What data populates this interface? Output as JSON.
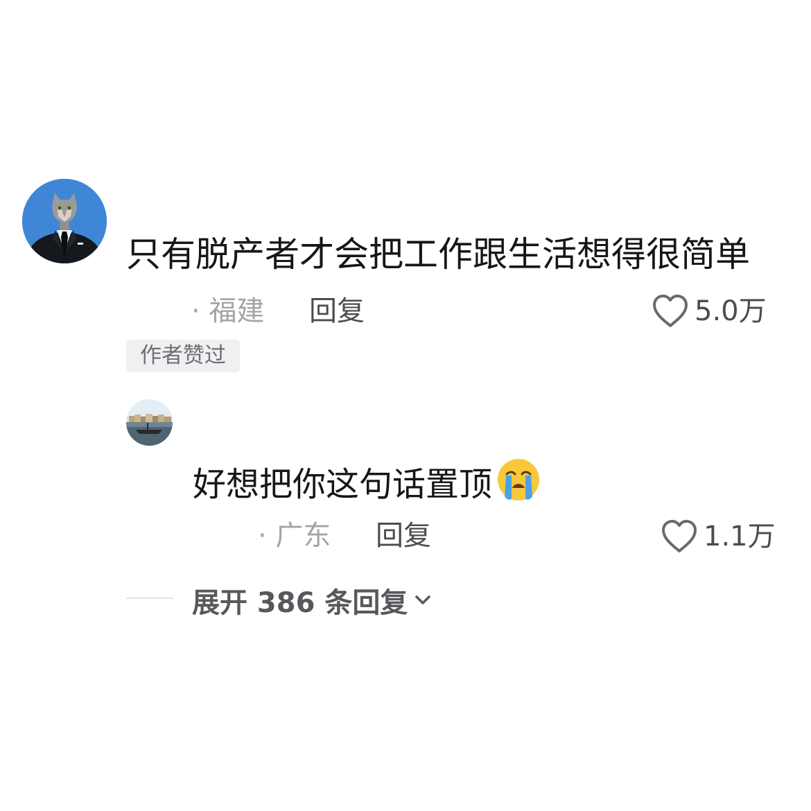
{
  "comments": [
    {
      "text": "只有脱产者才会把工作跟生活想得很简单",
      "location": "· 福建",
      "reply_label": "回复",
      "likes": "5.0万",
      "badge": "作者赞过"
    },
    {
      "text": "好想把你这句话置顶",
      "emoji": "crying-face-icon",
      "location": "· 广东",
      "reply_label": "回复",
      "likes": "1.1万"
    }
  ],
  "expand": {
    "label": "展开 386 条回复"
  },
  "colors": {
    "text_primary": "#161616",
    "text_meta": "#a4a4a8",
    "text_action": "#4c4c50",
    "badge_bg": "#f0f0f3",
    "avatar_main_bg": "#3f86d6"
  }
}
